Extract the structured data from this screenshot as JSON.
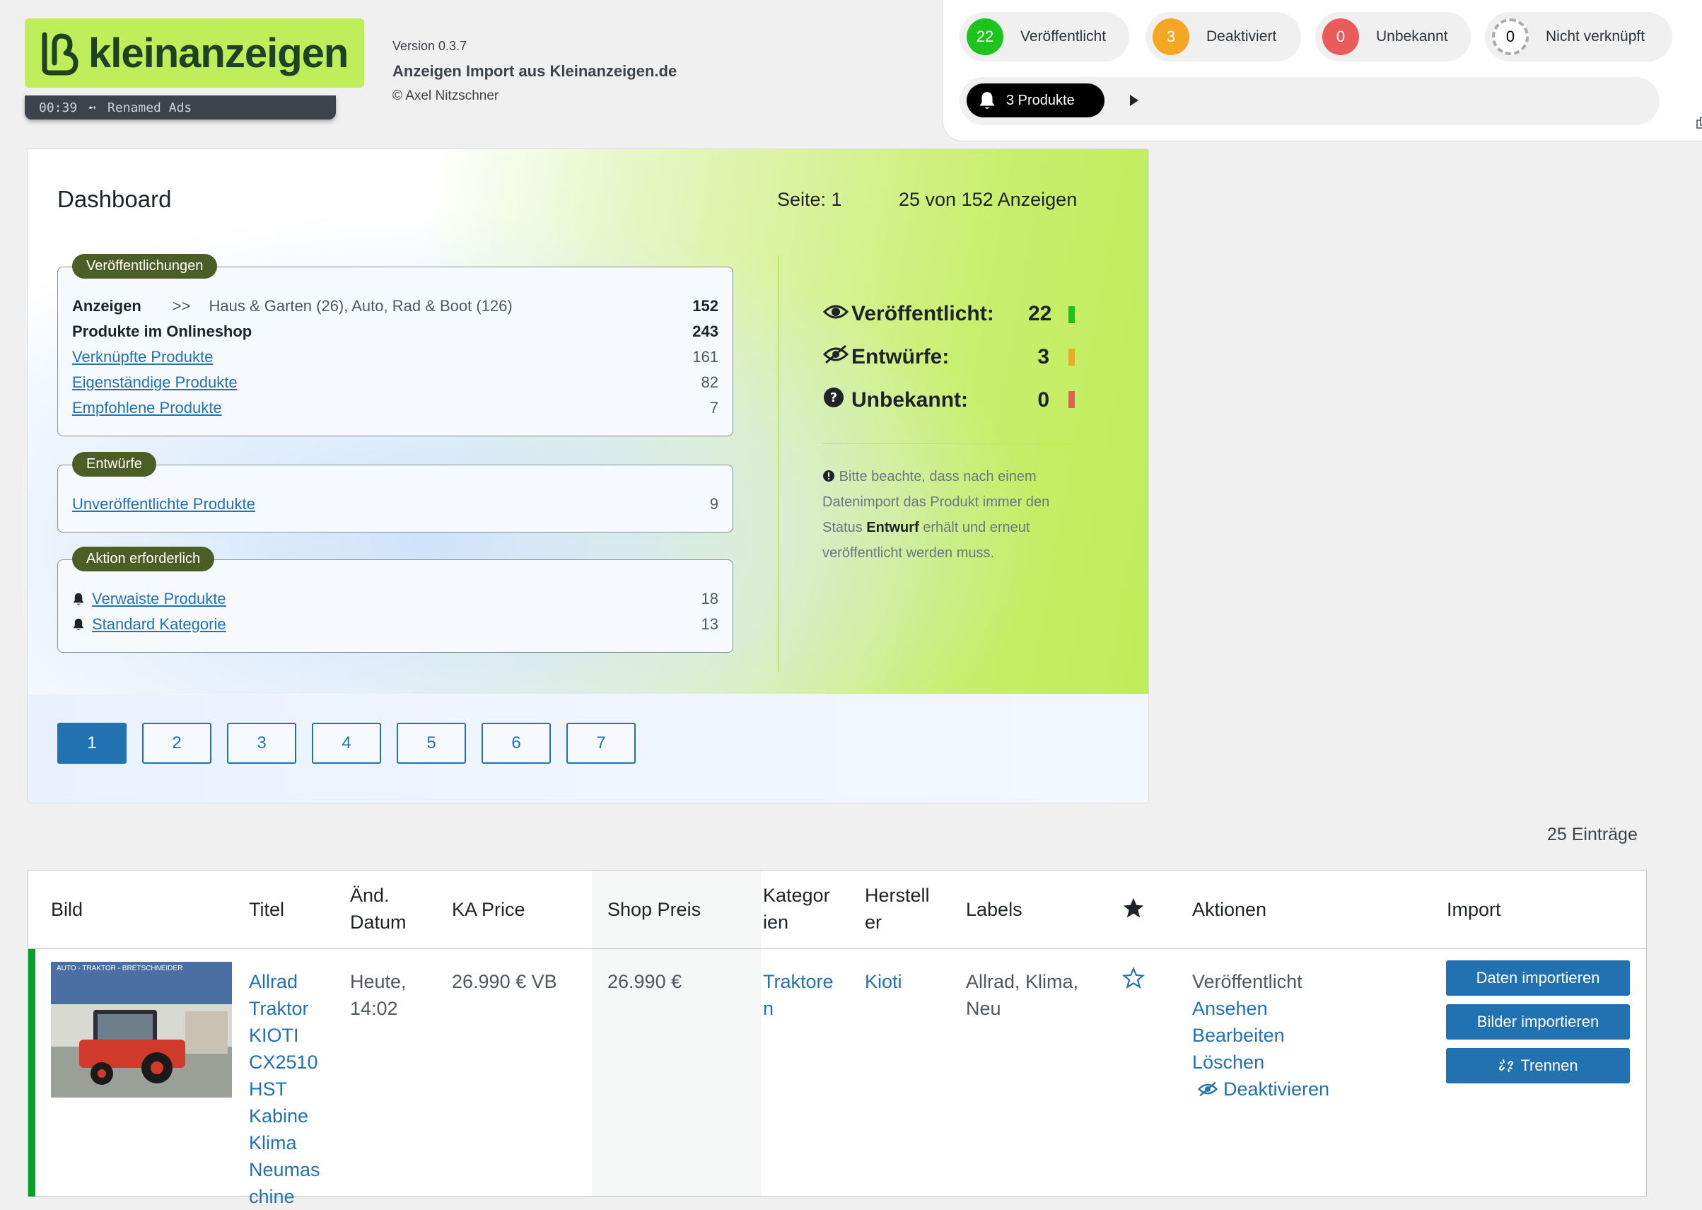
{
  "header": {
    "brand": "kleinanzeigen",
    "timer": "00:39",
    "timer_icon": "key-arrow-icon",
    "timer_text": "Renamed Ads",
    "version": "Version 0.3.7",
    "plugin_title": "Anzeigen Import aus Kleinanzeigen.de",
    "author": "© Axel Nitzschner"
  },
  "status_panel": {
    "pills": [
      {
        "count": "22",
        "label": "Veröffentlicht",
        "color": "#1ec41e"
      },
      {
        "count": "3",
        "label": "Deaktiviert",
        "color": "#f5a623"
      },
      {
        "count": "0",
        "label": "Unbekannt",
        "color": "#ec5b5b"
      },
      {
        "count": "0",
        "label": "Nicht verknüpft",
        "color": "#ffffff"
      }
    ],
    "products_badge": "3 Produkte"
  },
  "dashboard": {
    "title": "Dashboard",
    "page": "Seite: 1",
    "count": "25 von 152 Anzeigen",
    "publications": {
      "tag": "Veröffentlichungen",
      "anzeigen_label": "Anzeigen",
      "anzeigen_sep": ">>",
      "anzeigen_categories": "Haus & Garten (26), Auto, Rad & Boot (126)",
      "anzeigen_count": "152",
      "shop_label": "Produkte im Onlineshop",
      "shop_count": "243",
      "linked_label": "Verknüpfte Produkte",
      "linked_count": "161",
      "independent_label": "Eigenständige Produkte",
      "independent_count": "82",
      "recommended_label": "Empfohlene Produkte",
      "recommended_count": "7"
    },
    "drafts": {
      "tag": "Entwürfe",
      "unpublished_label": "Unveröffentlichte Produkte",
      "unpublished_count": "9"
    },
    "action": {
      "tag": "Aktion erforderlich",
      "orphan_label": "Verwaiste Produkte",
      "orphan_count": "18",
      "default_cat_label": "Standard Kategorie",
      "default_cat_count": "13"
    },
    "stats": [
      {
        "label": "Veröffentlicht:",
        "value": "22",
        "color": "#1ec41e"
      },
      {
        "label": "Entwürfe:",
        "value": "3",
        "color": "#f5a623"
      },
      {
        "label": "Unbekannt:",
        "value": "0",
        "color": "#ec5b5b"
      }
    ],
    "hint_pre": "Bitte beachte, dass nach einem Datenimport das Produkt immer den Status",
    "hint_bold": "Entwurf",
    "hint_post": "erhält und erneut veröffentlicht werden muss.",
    "pages": [
      "1",
      "2",
      "3",
      "4",
      "5",
      "6",
      "7"
    ]
  },
  "entries_count": "25 Einträge",
  "table": {
    "headers": {
      "image": "Bild",
      "title": "Titel",
      "date": "Änd. Datum",
      "ka_price": "KA Price",
      "shop_price": "Shop Preis",
      "categories": "Kategor ien",
      "manufacturer": "Herstell er",
      "labels": "Labels",
      "featured_icon": "star-filled-icon",
      "actions": "Aktionen",
      "import": "Import"
    },
    "rows": [
      {
        "image_sign": "AUTO - TRAKTOR - BRETSCHNEIDER",
        "title": "Allrad Traktor KIOTI CX2510 HST Kabine Klima Neumas chine",
        "date": "Heute, 14:02",
        "ka_price": "26.990 € VB",
        "shop_price": "26.990 €",
        "category": "Traktore n",
        "manufacturer": "Kioti",
        "labels": "Allrad, Klima, Neu",
        "status": "Veröffentlicht",
        "action_view": "Ansehen",
        "action_edit": "Bearbeiten",
        "action_delete": "Löschen",
        "action_deactivate": "Deaktivieren",
        "btn_data": "Daten importieren",
        "btn_images": "Bilder importieren",
        "btn_unlink": "Trennen"
      }
    ]
  }
}
